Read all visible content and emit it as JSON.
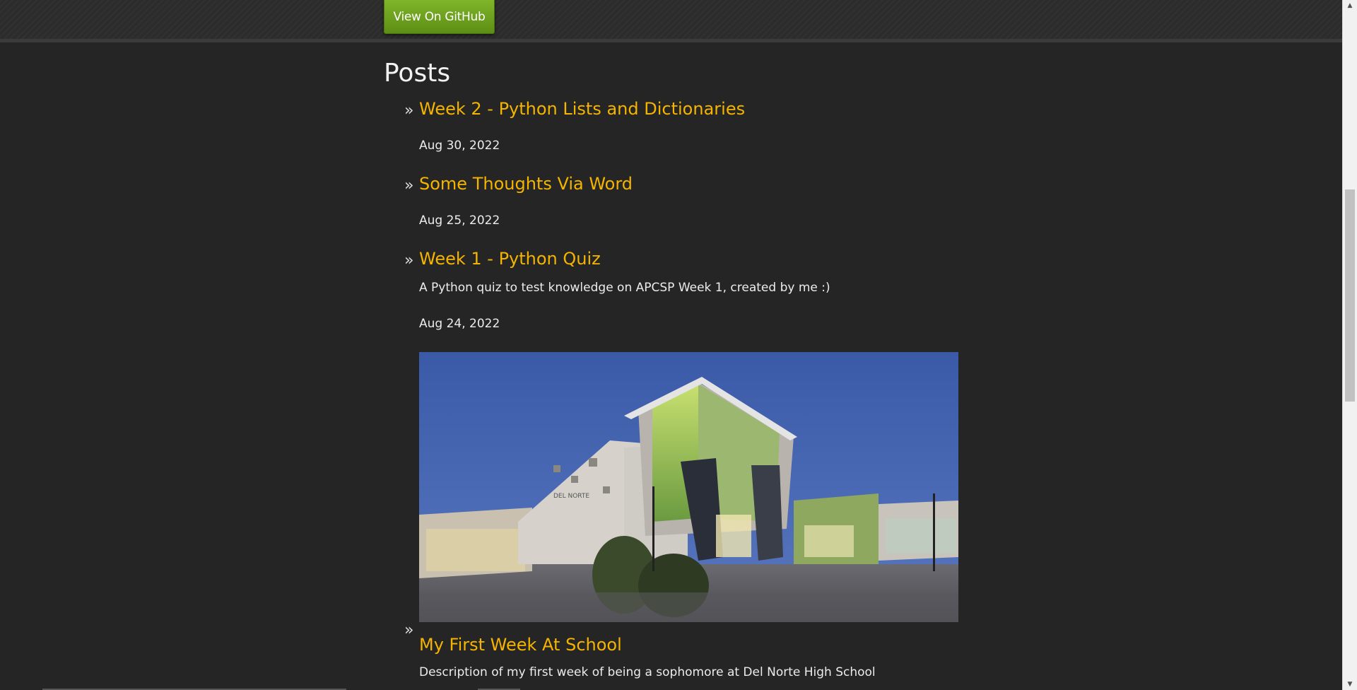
{
  "header": {
    "github_button_label": "View On GitHub"
  },
  "posts_section": {
    "heading": "Posts",
    "bullet": "»",
    "posts": [
      {
        "title": "Week 2 - Python Lists and Dictionaries",
        "description": "",
        "date": "Aug 30, 2022"
      },
      {
        "title": "Some Thoughts Via Word",
        "description": "",
        "date": "Aug 25, 2022"
      },
      {
        "title": "Week 1 - Python Quiz",
        "description": "A Python quiz to test knowledge on APCSP Week 1, created by me :)",
        "date": "Aug 24, 2022"
      },
      {
        "title": "My First Week At School",
        "description": "Description of my first week of being a sophomore at Del Norte High School",
        "image_sign_text": "DEL NORTE"
      }
    ]
  },
  "colors": {
    "background": "#252525",
    "link": "#f4b400",
    "button": "#6a9c1c"
  },
  "icons": {
    "scroll_up": "triangle-up-icon",
    "scroll_down": "triangle-down-icon"
  }
}
